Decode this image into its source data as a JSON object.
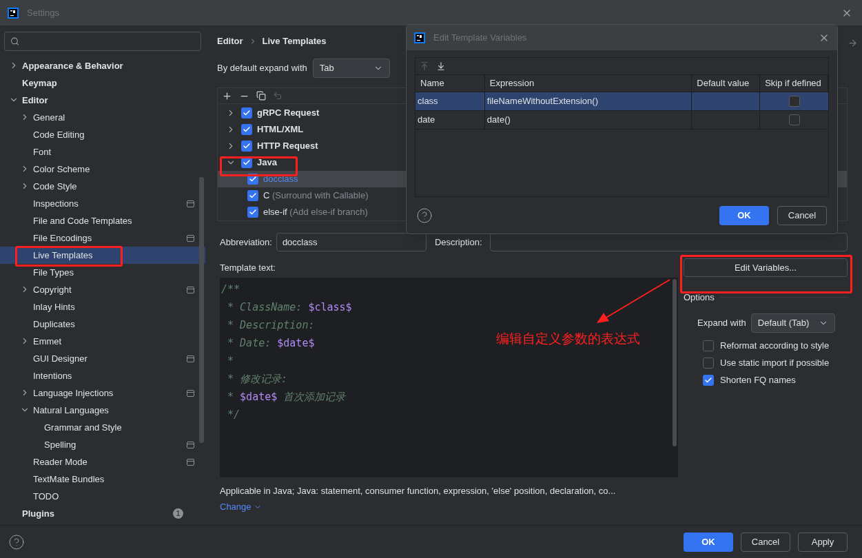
{
  "window": {
    "title": "Settings"
  },
  "sidebar": {
    "items": [
      {
        "label": "Appearance & Behavior",
        "expanded": false,
        "selected": false
      },
      {
        "label": "Keymap",
        "selected": false
      },
      {
        "label": "Editor",
        "expanded": true,
        "selected": false,
        "children": [
          {
            "label": "General",
            "expanded": false,
            "selected": false
          },
          {
            "label": "Code Editing",
            "selected": false
          },
          {
            "label": "Font",
            "selected": false
          },
          {
            "label": "Color Scheme",
            "expanded": false,
            "selected": false
          },
          {
            "label": "Code Style",
            "expanded": false,
            "selected": false
          },
          {
            "label": "Inspections",
            "scoped": true,
            "selected": false
          },
          {
            "label": "File and Code Templates",
            "selected": false
          },
          {
            "label": "File Encodings",
            "scoped": true,
            "selected": false
          },
          {
            "label": "Live Templates",
            "selected": true
          },
          {
            "label": "File Types",
            "selected": false
          },
          {
            "label": "Copyright",
            "expanded": false,
            "scoped": true,
            "selected": false
          },
          {
            "label": "Inlay Hints",
            "selected": false
          },
          {
            "label": "Duplicates",
            "selected": false
          },
          {
            "label": "Emmet",
            "expanded": false,
            "selected": false
          },
          {
            "label": "GUI Designer",
            "scoped": true,
            "selected": false
          },
          {
            "label": "Intentions",
            "selected": false
          },
          {
            "label": "Language Injections",
            "expanded": false,
            "scoped": true,
            "selected": false
          },
          {
            "label": "Natural Languages",
            "expanded": true,
            "selected": false,
            "children": [
              {
                "label": "Grammar and Style",
                "selected": false
              },
              {
                "label": "Spelling",
                "scoped": true,
                "selected": false
              }
            ]
          },
          {
            "label": "Reader Mode",
            "scoped": true,
            "selected": false
          },
          {
            "label": "TextMate Bundles",
            "selected": false
          },
          {
            "label": "TODO",
            "selected": false
          }
        ]
      },
      {
        "label": "Plugins",
        "badge": "1",
        "selected": false
      }
    ]
  },
  "breadcrumb": [
    "Editor",
    "Live Templates"
  ],
  "expand_default": {
    "label": "By default expand with",
    "value": "Tab"
  },
  "templates": [
    {
      "name": "gRPC Request",
      "checked": true,
      "expanded": false,
      "selected": false
    },
    {
      "name": "HTML/XML",
      "checked": true,
      "expanded": false,
      "selected": false
    },
    {
      "name": "HTTP Request",
      "checked": true,
      "expanded": false,
      "selected": false
    },
    {
      "name": "Java",
      "checked": true,
      "expanded": true,
      "selected": false,
      "children": [
        {
          "name": "docclass",
          "checked": true,
          "selected": true
        },
        {
          "name": "C",
          "description": "(Surround with Callable)",
          "checked": true,
          "selected": false
        },
        {
          "name": "else-if",
          "description": "(Add else-if branch)",
          "checked": true,
          "selected": false
        }
      ]
    }
  ],
  "abbreviation": {
    "label": "Abbreviation:",
    "value": "docclass"
  },
  "description": {
    "label": "Description:"
  },
  "template_text": {
    "label": "Template text:",
    "lines": [
      [
        {
          "kind": "comment",
          "text": "/**"
        }
      ],
      [
        {
          "kind": "comment",
          "text": " * ClassName: "
        },
        {
          "kind": "variable",
          "text": "$class$"
        }
      ],
      [
        {
          "kind": "comment",
          "text": " * Description:"
        }
      ],
      [
        {
          "kind": "comment",
          "text": " * Date: "
        },
        {
          "kind": "variable",
          "text": "$date$"
        }
      ],
      [
        {
          "kind": "comment",
          "text": " *"
        }
      ],
      [
        {
          "kind": "comment",
          "text": " * 修改记录:"
        }
      ],
      [
        {
          "kind": "comment",
          "text": " * "
        },
        {
          "kind": "variable",
          "text": "$date$"
        },
        {
          "kind": "comment",
          "text": " 首次添加记录"
        }
      ],
      [
        {
          "kind": "comment",
          "text": " */"
        }
      ]
    ]
  },
  "annotation": {
    "text": "编辑自定义参数的表达式"
  },
  "edit_variables_button": "Edit Variables...",
  "options": {
    "title": "Options",
    "expand_label": "Expand with",
    "expand_value": "Default (Tab)",
    "checks": [
      {
        "label": "Reformat according to style",
        "checked": false
      },
      {
        "label": "Use static import if possible",
        "checked": false
      },
      {
        "label": "Shorten FQ names",
        "checked": true
      }
    ]
  },
  "applicable": "Applicable in Java; Java: statement, consumer function, expression, 'else' position, declaration, co...",
  "change_link": "Change",
  "dialog": {
    "title": "Edit Template Variables",
    "columns": [
      "Name",
      "Expression",
      "Default value",
      "Skip if defined"
    ],
    "rows": [
      {
        "name": "class",
        "expression": "fileNameWithoutExtension()",
        "skip": false,
        "selected": true
      },
      {
        "name": "date",
        "expression": "date()",
        "skip": false,
        "selected": false
      }
    ],
    "buttons": [
      "OK",
      "Cancel"
    ]
  },
  "footer": {
    "buttons": [
      "OK",
      "Cancel",
      "Apply"
    ]
  }
}
